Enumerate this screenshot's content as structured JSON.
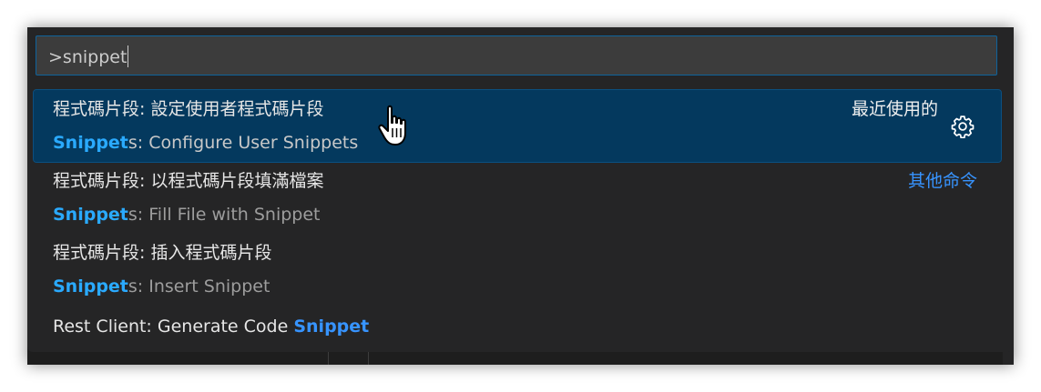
{
  "quick_pick": {
    "input_value": ">snippet",
    "items": [
      {
        "label_zh": "程式碼片段: 設定使用者程式碼片段",
        "label_en_match": "Snippet",
        "label_en_rest": "s: Configure User Snippets",
        "detail": "最近使用的",
        "selected": true,
        "icon": "gear-icon"
      },
      {
        "label_zh": "程式碼片段: 以程式碼片段填滿檔案",
        "label_en_match": "Snippet",
        "label_en_rest": "s: Fill File with Snippet",
        "detail": "其他命令"
      },
      {
        "label_zh": "程式碼片段: 插入程式碼片段",
        "label_en_match": "Snippet",
        "label_en_rest": "s: Insert Snippet"
      },
      {
        "label_prefix": "Rest Client: Generate Code ",
        "label_match": "Snippet"
      }
    ]
  },
  "colors": {
    "background": "#252526",
    "selected": "#04395e",
    "highlight": "#2aaaff",
    "detail_link": "#3794ff",
    "input_border": "#0e639c"
  }
}
